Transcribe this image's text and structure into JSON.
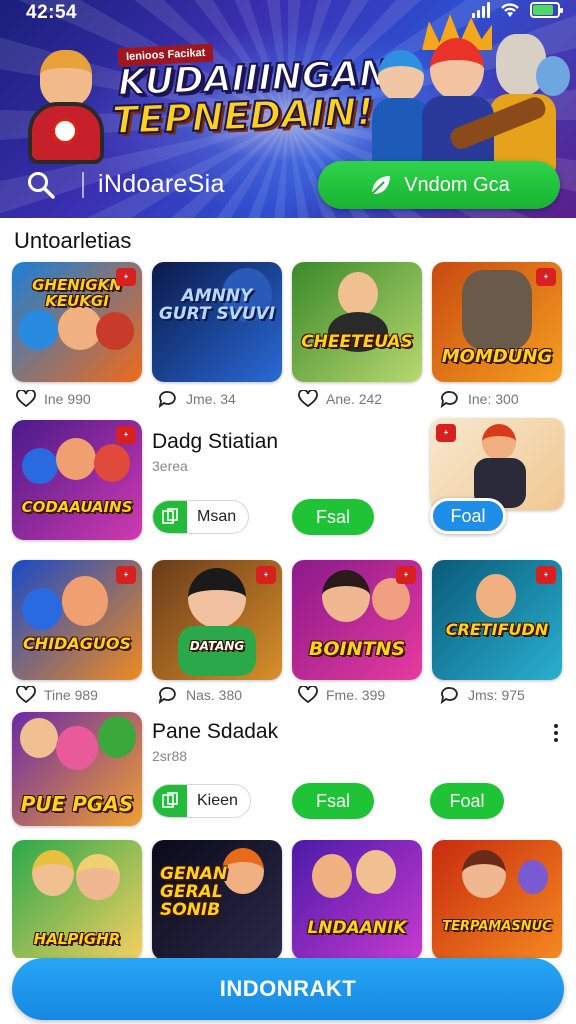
{
  "status": {
    "time": "42:54",
    "battery_level": 0.85
  },
  "banner": {
    "badge": "Ienioos Facikat",
    "title_line1": "KUDAIIINGAN",
    "title_line2": "TEPNEDAIN!",
    "search_icon": "search-icon",
    "bar_title": "iNdoareSia",
    "cta_label": "Vndom Gca",
    "cta_icon": "leaf-icon"
  },
  "section": {
    "title": "Untoarletias"
  },
  "grid_row_1": [
    {
      "tile_text": "GHENIGKN KEUKGI",
      "meta_icon": "heart-icon",
      "meta": "Ine 990",
      "colors": [
        "#1b7fd6",
        "#f06a1a"
      ]
    },
    {
      "tile_text": "AMNNY GURT SVUVI",
      "meta_icon": "chat-icon",
      "meta": "Jme. 34",
      "colors": [
        "#0a1a4a",
        "#2a6ad8"
      ]
    },
    {
      "tile_text": "CHEETEUAS",
      "meta_icon": "heart-icon",
      "meta": "Ane. 242",
      "colors": [
        "#3a8a2a",
        "#b8d870"
      ]
    },
    {
      "tile_text": "MOMDUNG",
      "meta_icon": "chat-icon",
      "meta": "Ine: 300",
      "colors": [
        "#c84a10",
        "#f5a020"
      ]
    }
  ],
  "list_row_1": {
    "tile_text": "CODAAUAINS",
    "title": "Dadg Stiatian",
    "subtitle": "3erea",
    "chip_label": "Msan",
    "pill_green": "Fsal",
    "pill_blue": "Foal"
  },
  "grid_row_2": [
    {
      "tile_text": "CHIDAGUOS",
      "meta_icon": "heart-icon",
      "meta": "Tine 989",
      "colors": [
        "#1a4ac8",
        "#f08a20"
      ]
    },
    {
      "tile_text": "DATANG",
      "meta_icon": "chat-icon",
      "meta": "Nas. 380",
      "colors": [
        "#6a3a1a",
        "#d8902a"
      ]
    },
    {
      "tile_text": "BOINTNS",
      "meta_icon": "heart-icon",
      "meta": "Fme. 399",
      "colors": [
        "#8a1a8a",
        "#e83aa0"
      ]
    },
    {
      "tile_text": "CRETIFUDN",
      "meta_icon": "chat-icon",
      "meta": "Jms: 975",
      "colors": [
        "#0a5a7a",
        "#2ab0d0"
      ]
    }
  ],
  "list_row_2": {
    "tile_text": "PUE PGAS",
    "title": "Pane Sdadak",
    "subtitle": "2sr88",
    "chip_label": "Kieen",
    "pill_green": "Fsal",
    "pill_green_2": "Foal"
  },
  "grid_row_3": [
    {
      "tile_text": "HALPIGHR",
      "colors": [
        "#2aa84a",
        "#f6d060"
      ]
    },
    {
      "tile_text": "GENAN GERAL SONIB",
      "colors": [
        "#0a0a1a",
        "#2a2a4a"
      ]
    },
    {
      "tile_text": "LNDAANIK",
      "colors": [
        "#4a1aa8",
        "#c83ad0"
      ]
    },
    {
      "tile_text": "TERPAMASNUC",
      "colors": [
        "#c82a10",
        "#f58a20"
      ]
    }
  ],
  "bottom": {
    "button_label": "INDONRAKT"
  },
  "colors": {
    "accent_green": "#1ec435",
    "accent_blue": "#1e8ee8"
  }
}
